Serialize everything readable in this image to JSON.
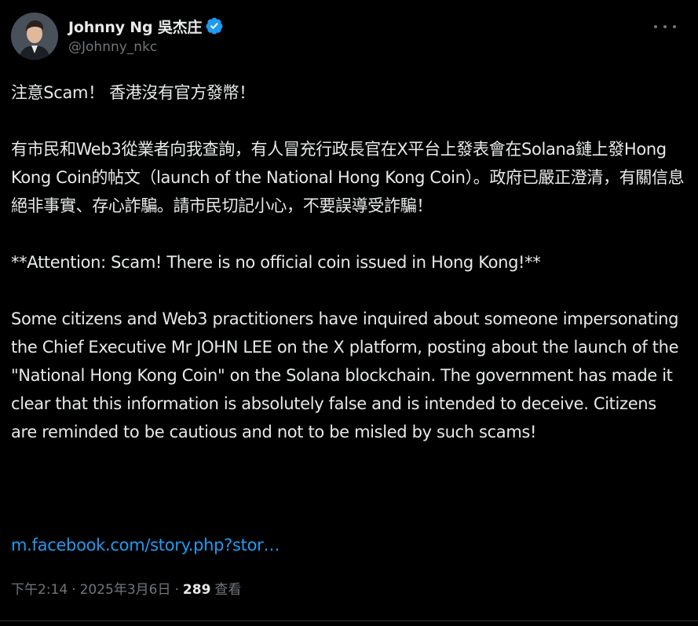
{
  "author": {
    "display_name": "Johnny Ng 吳杰庄",
    "handle": "@Johnny_nkc",
    "verified": true,
    "avatar_icon": "person-avatar"
  },
  "more_icon": "more-horizontal-icon",
  "post": {
    "paragraphs": [
      "注意Scam！ 香港沒有官方發幣！",
      "有市民和Web3從業者向我查詢，有人冒充行政長官在X平台上發表會在Solana鏈上發Hong Kong Coin的帖文（launch of the National Hong Kong Coin）。政府已嚴正澄清，有關信息絕非事實、存心詐騙。請市民切記小心，不要誤導受詐騙！",
      "**Attention: Scam! There is no official coin issued in Hong Kong!**",
      "Some citizens and Web3 practitioners have inquired about someone impersonating the Chief Executive Mr JOHN LEE on the X platform, posting about the launch of the \"National Hong Kong Coin\" on the Solana blockchain. The government has made it clear that this information is absolutely false and is intended to deceive. Citizens are reminded to be cautious and not to be misled by such scams!"
    ],
    "link": "m.facebook.com/story.php?stor…"
  },
  "meta": {
    "time": "下午2:14",
    "separator": "·",
    "date": "2025年3月6日",
    "views_count": "289",
    "views_label": "查看"
  },
  "colors": {
    "background": "#000000",
    "text": "#e7e9ea",
    "secondary": "#71767b",
    "link": "#1d9bf0",
    "verified": "#1d9bf0"
  }
}
